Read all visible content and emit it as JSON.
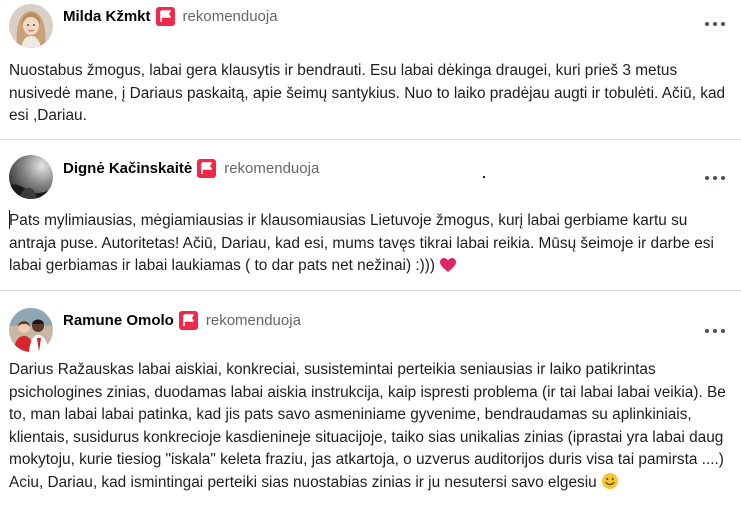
{
  "reviews": [
    {
      "author": "Milda Kžmkt",
      "action": "rekomenduoja",
      "avatar": "woman-portrait",
      "text": "Nuostabus žmogus, labai gera klausytis ir bendrauti. Esu labai dėkinga draugei, kuri prieš 3 metus nusivedė mane, į Dariaus paskaitą, apie šeimų santykius. Nuo to laiko pradėjau augti ir tobulėti. Ačiū, kad esi ,Dariau."
    },
    {
      "author": "Dignė Kačinskaitė",
      "action": "rekomenduoja",
      "avatar": "dark-sky-photo",
      "text": "Pats mylimiausias, mėgiamiausias ir klausomiausias Lietuvoje žmogus, kurį labai gerbiame kartu su antraja puse. Autoritetas! Ačiū, Dariau, kad esi, mums tavęs tikrai labai reikia. Mūsų šeimoje ir darbe esi labai gerbiamas ir labai laukiamas ( to dar pats net nežinai) :)))",
      "emoji": "red-heart"
    },
    {
      "author": "Ramune Omolo",
      "action": "rekomenduoja",
      "avatar": "couple-photo",
      "text": "Darius Ražauskas labai aiskiai, konkreciai, susistemintai perteikia seniausias ir laiko patikrintas psichologines zinias, duodamas labai aiskia instrukcija, kaip ispresti problema (ir tai labai labai veikia). Be to, man labai labai patinka, kad jis pats savo asmeniniame gyvenime, bendraudamas su aplinkiniais, klientais, susidurus konkrecioje kasdienineje situacijoje, taiko sias unikalias zinias (iprastai yra labai daug mokytoju, kurie tiesiog \"iskala\" keleta fraziu, jas atkartoja, o uzverus auditorijos duris visa tai pamirsta ....) Aciu, Dariau, kad ismintingai perteiki sias nuostabias zinias ir ju nesutersi savo elgesiu",
      "emoji": "smiling-face"
    }
  ],
  "icons": {
    "badge": "recommend-flag-icon",
    "more": "more-options-icon"
  },
  "colors": {
    "badge": "#f02849",
    "action_text": "#65676b",
    "separator": "#dadde1"
  }
}
